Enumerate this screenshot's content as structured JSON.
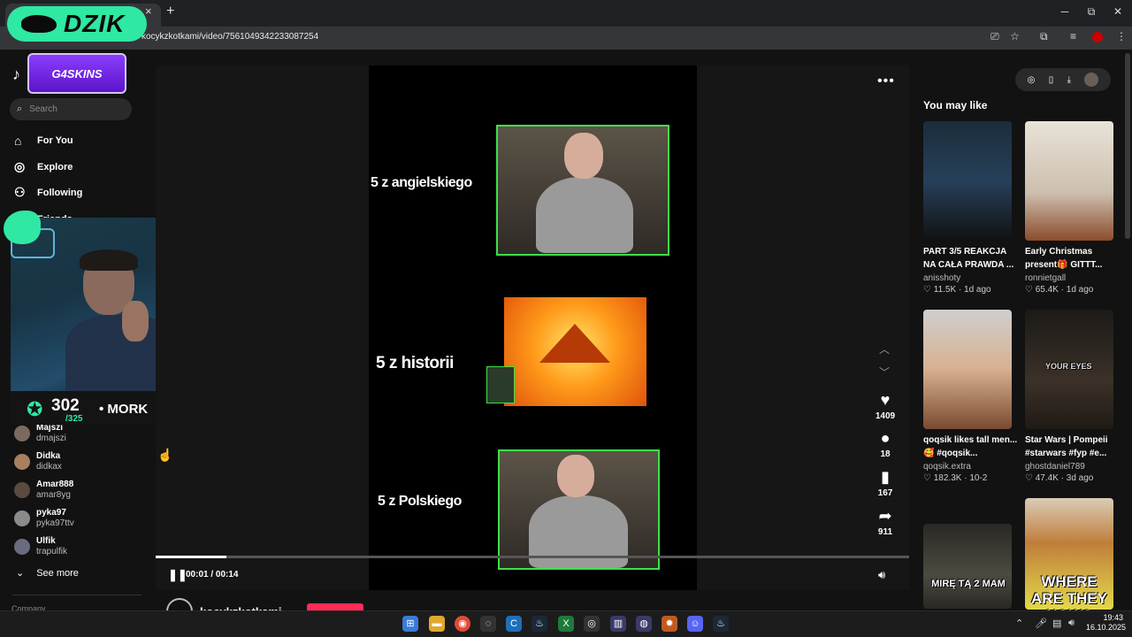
{
  "browser": {
    "url": "kocykzkotkami/video/7561049342233087254",
    "tab_close": "×",
    "new_tab": "+",
    "controls": {
      "minimize": "─",
      "restore": "⧉",
      "close": "✕"
    }
  },
  "overlays": {
    "dzik": "DZIK",
    "g4skins": "G4SKINS",
    "stream_count": "302",
    "stream_goal": "/325",
    "streamer": "MORK"
  },
  "sidebar": {
    "search_placeholder": "Search",
    "nav": [
      {
        "label": "For You",
        "icon": "home-icon"
      },
      {
        "label": "Explore",
        "icon": "compass-icon"
      },
      {
        "label": "Following",
        "icon": "following-icon"
      },
      {
        "label": "Friends",
        "icon": "friends-icon"
      }
    ],
    "following_header": "Fo",
    "following": [
      {
        "name": "Majszi",
        "user": "dmajszi"
      },
      {
        "name": "Didka",
        "user": "didkax"
      },
      {
        "name": "Amar888",
        "user": "amar8yg"
      },
      {
        "name": "pyka97",
        "user": "pyka97ttv"
      },
      {
        "name": "Ulfik",
        "user": "trapulfik"
      }
    ],
    "see_more": "See more",
    "company": "Company"
  },
  "video": {
    "captions": [
      "5 z angielskiego",
      "5 z historii",
      "5 z Polskiego"
    ],
    "progress_fraction": 0.094,
    "time": "00:01 / 00:14",
    "actions": {
      "likes": "1409",
      "comments": "18",
      "saves": "167",
      "shares": "911"
    },
    "creator": "kocykzkotkami"
  },
  "you_may_like": {
    "title": "You may like",
    "cards": [
      {
        "title": "PART 3/5 REAKCJA NA CAŁA PRAWDA ...",
        "user": "anisshoty",
        "likes": "11.5K",
        "age": "1d ago",
        "overlay": ""
      },
      {
        "title": "Early Christmas present🎁 GITTT...",
        "user": "ronnietgall",
        "likes": "65.4K",
        "age": "1d ago",
        "overlay": ""
      },
      {
        "title": "qoqsik likes tall men... 🥰 #qoqsik...",
        "user": "qoqsik.extra",
        "likes": "182.3K",
        "age": "10-2",
        "overlay": ""
      },
      {
        "title": "Star Wars | Pompeii #starwars #fyp #e...",
        "user": "ghostdaniel789",
        "likes": "47.4K",
        "age": "3d ago",
        "overlay": "YOUR EYES"
      },
      {
        "title": "",
        "user": "",
        "likes": "",
        "age": "",
        "overlay": "MIRĘ TĄ 2 MAM"
      },
      {
        "title": "",
        "user": "",
        "likes": "",
        "age": "",
        "overlay": "WHERE ARE THEY NOW?"
      }
    ]
  },
  "taskbar": {
    "time": "19:43",
    "date": "16.10.2025"
  }
}
